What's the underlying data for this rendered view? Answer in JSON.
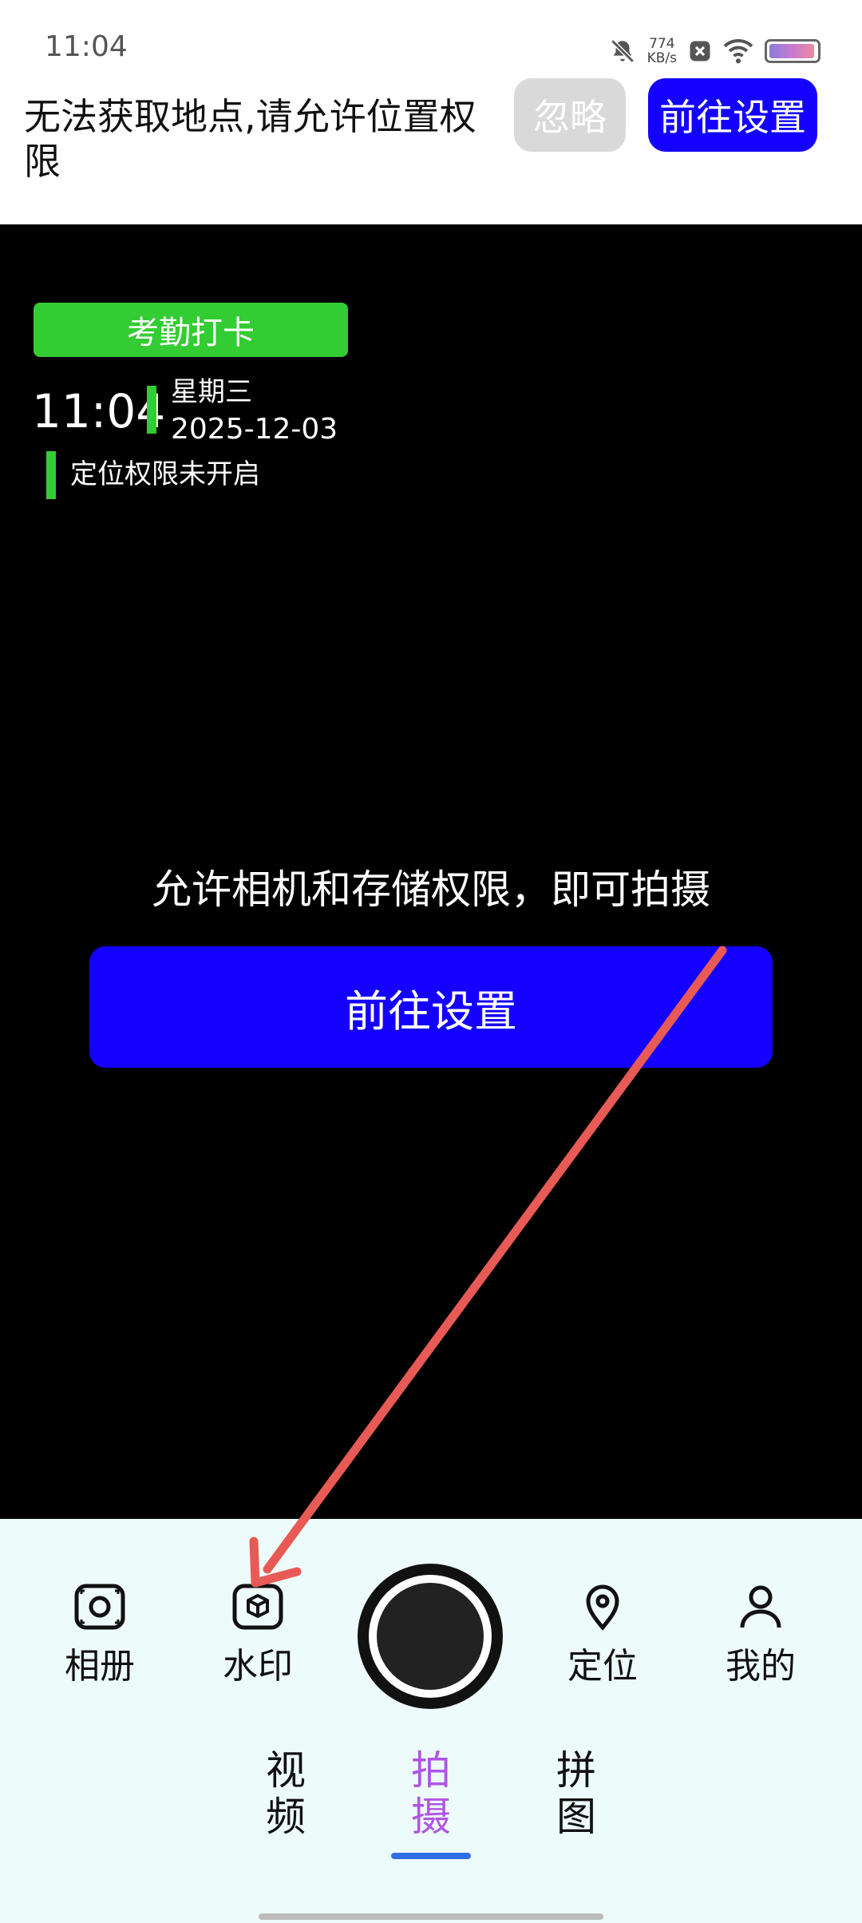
{
  "status_bar": {
    "time": "11:04",
    "net_speed_value": "774",
    "net_speed_unit": "KB/s",
    "icons": [
      "mute-bell-icon",
      "close-badge-icon",
      "wifi-icon",
      "battery-icon"
    ]
  },
  "banner": {
    "message": "无法获取地点,请允许位置权限",
    "ignore_label": "忽略",
    "settings_label": "前往设置"
  },
  "watermark": {
    "tag": "考勤打卡",
    "time": "11:04",
    "weekday": "星期三",
    "date": "2025-12-03",
    "location": "定位权限未开启"
  },
  "permission": {
    "message": "允许相机和存储权限，即可拍摄",
    "button_label": "前往设置"
  },
  "toolbar": {
    "album": "相册",
    "watermark": "水印",
    "location": "定位",
    "mine": "我的"
  },
  "modes": [
    {
      "label": "视频",
      "active": false
    },
    {
      "label": "拍摄",
      "active": true
    },
    {
      "label": "拼图",
      "active": false
    }
  ],
  "colors": {
    "accent_blue": "#1400FF",
    "tag_green": "#33CC33",
    "active_mode": "#B055E6",
    "annotation_arrow": "#E85A55"
  }
}
